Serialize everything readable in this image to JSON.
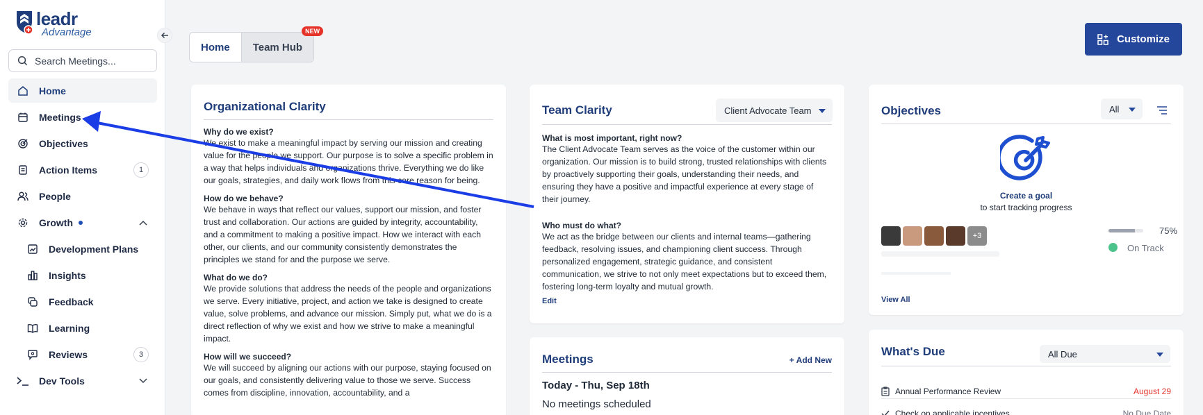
{
  "brand": {
    "name": "leadr",
    "sub": "Advantage"
  },
  "search": {
    "placeholder": "Search Meetings..."
  },
  "sidebar": {
    "items": [
      {
        "label": "Home",
        "icon": "home-icon",
        "active": true
      },
      {
        "label": "Meetings",
        "icon": "calendar-icon"
      },
      {
        "label": "Objectives",
        "icon": "target-icon"
      },
      {
        "label": "Action Items",
        "icon": "checklist-icon",
        "badge": "1"
      },
      {
        "label": "People",
        "icon": "people-icon"
      },
      {
        "label": "Growth",
        "icon": "gear-icon"
      },
      {
        "label": "Development Plans",
        "icon": "chart-icon"
      },
      {
        "label": "Insights",
        "icon": "bar-chart-icon"
      },
      {
        "label": "Feedback",
        "icon": "feedback-icon"
      },
      {
        "label": "Learning",
        "icon": "book-icon"
      },
      {
        "label": "Reviews",
        "icon": "review-icon",
        "badge": "3"
      },
      {
        "label": "Dev Tools",
        "icon": "terminal-icon"
      }
    ]
  },
  "tabs": {
    "home": "Home",
    "team_hub": "Team Hub",
    "new_badge": "NEW"
  },
  "toolbar": {
    "customize": "Customize"
  },
  "org_clarity": {
    "title": "Organizational Clarity",
    "sections": [
      {
        "q": "Why do we exist?",
        "a": "We exist to make a meaningful impact by serving our mission and creating value for the people we support. Our purpose is to solve a specific problem in a way that helps individuals and organizations thrive. Everything we do like our goals, strategies, and daily work flows from this core reason for being."
      },
      {
        "q": "How do we behave?",
        "a": "We behave in ways that reflect our values, support our mission, and foster trust and collaboration. Our actions are guided by integrity, accountability, and a commitment to making a positive impact. How we interact with each other, our clients, and our community consistently demonstrates the principles we stand for and the purpose we serve."
      },
      {
        "q": "What do we do?",
        "a": "We provide solutions that address the needs of the people and organizations we serve. Every initiative, project, and action we take is designed to create value, solve problems, and advance our mission. Simply put, what we do is a direct reflection of why we exist and how we strive to make a meaningful impact."
      },
      {
        "q": "How will we succeed?",
        "a": "We will succeed by aligning our actions with our purpose, staying focused on our goals, and consistently delivering value to those we serve. Success comes from discipline, innovation, accountability, and a"
      }
    ]
  },
  "team_clarity": {
    "title": "Team Clarity",
    "team_select": "Client Advocate Team",
    "sections": [
      {
        "q": "What is most important, right now?",
        "a": "The Client Advocate Team serves as the voice of the customer within our organization. Our mission is to build strong, trusted relationships with clients by proactively supporting their goals, understanding their needs, and ensuring they have a positive and impactful experience at every stage of their journey."
      },
      {
        "q": "Who must do what?",
        "a": "We act as the bridge between our clients and internal teams—gathering feedback, resolving issues, and championing client success. Through personalized engagement, strategic guidance, and consistent communication, we strive to not only meet expectations but to exceed them, fostering long-term loyalty and mutual growth."
      }
    ],
    "edit": "Edit"
  },
  "meetings": {
    "title": "Meetings",
    "add_new": "+ Add New",
    "date": "Today - Thu, Sep 18th",
    "empty": "No meetings scheduled"
  },
  "objectives": {
    "title": "Objectives",
    "filter": "All",
    "create": "Create a goal",
    "create_sub": "to start tracking progress",
    "more_count": "+3",
    "progress": "75%",
    "progress_value": 0.75,
    "status": "On Track",
    "status_color": "#4cc38a",
    "view_all": "View All"
  },
  "whats_due": {
    "title": "What's Due",
    "filter": "All Due",
    "items": [
      {
        "label": "Annual Performance Review",
        "date": "August 29",
        "date_color": "#e5332a"
      },
      {
        "label": "Check on applicable incentives",
        "date": "No Due Date",
        "date_color": "#6b7280"
      }
    ]
  },
  "colors": {
    "accent": "#1f3d7a",
    "button": "#24479c",
    "arrow": "#1a3de6"
  }
}
